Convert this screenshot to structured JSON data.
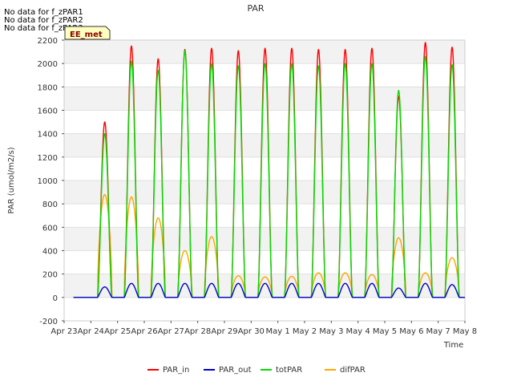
{
  "chart_data": {
    "type": "line",
    "title": "PAR",
    "xlabel": "Time",
    "ylabel": "PAR (umol/m2/s)",
    "notes": [
      "No data for f_zPAR1",
      "No data for f_zPAR2",
      "No data for f_zPAR3"
    ],
    "badge": "EE_met",
    "ylim": [
      -200,
      2200
    ],
    "yticks": [
      -200,
      0,
      200,
      400,
      600,
      800,
      1000,
      1200,
      1400,
      1600,
      1800,
      2000,
      2200
    ],
    "xlim": [
      0,
      15
    ],
    "xticks": [
      0,
      1,
      2,
      3,
      4,
      5,
      6,
      7,
      8,
      9,
      10,
      11,
      12,
      13,
      14,
      15
    ],
    "xtick_labels": [
      "Apr 23",
      "Apr 24",
      "Apr 25",
      "Apr 26",
      "Apr 27",
      "Apr 28",
      "Apr 29",
      "Apr 30",
      "May 1",
      "May 2",
      "May 3",
      "May 4",
      "May 5",
      "May 6",
      "May 7",
      "May 8"
    ],
    "x_unit": "days since Apr 23",
    "grid": true,
    "legend_position": "bottom",
    "series": [
      {
        "name": "PAR_in",
        "color": "#ff0000",
        "daily_peaks": [
          1500,
          2150,
          2040,
          2120,
          2130,
          2110,
          2130,
          2130,
          2120,
          2120,
          2130,
          1720,
          2180,
          2140
        ]
      },
      {
        "name": "PAR_out",
        "color": "#0000cc",
        "daily_peaks": [
          90,
          120,
          120,
          120,
          120,
          120,
          120,
          120,
          120,
          120,
          120,
          80,
          120,
          110
        ]
      },
      {
        "name": "totPAR",
        "color": "#00dd00",
        "daily_peaks": [
          1400,
          2020,
          1940,
          2110,
          2000,
          1980,
          2000,
          2000,
          1980,
          2000,
          2000,
          1770,
          2060,
          1990
        ]
      },
      {
        "name": "difPAR",
        "color": "#ffa500",
        "daily_peaks": [
          880,
          860,
          680,
          400,
          520,
          185,
          175,
          180,
          210,
          210,
          195,
          510,
          210,
          340
        ]
      }
    ],
    "day_start": 0.25,
    "day_end": 0.79
  }
}
